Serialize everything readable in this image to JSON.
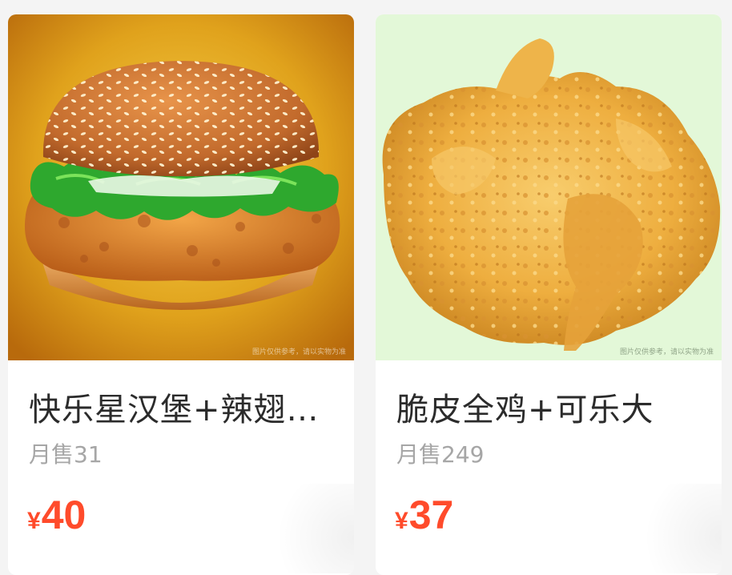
{
  "products": [
    {
      "title": "快乐星汉堡+辣翅…",
      "sales": "月售31",
      "currency": "¥",
      "price": "40",
      "image": "burger-photo",
      "bg_color": "#e0a21c"
    },
    {
      "title": "脆皮全鸡+可乐大",
      "sales": "月售249",
      "currency": "¥",
      "price": "37",
      "image": "fried-chicken-photo",
      "bg_color": "#e3f8d8"
    }
  ],
  "colors": {
    "price": "#ff4b2b",
    "title": "#2b2b2b",
    "sales": "#a6a6a6"
  }
}
